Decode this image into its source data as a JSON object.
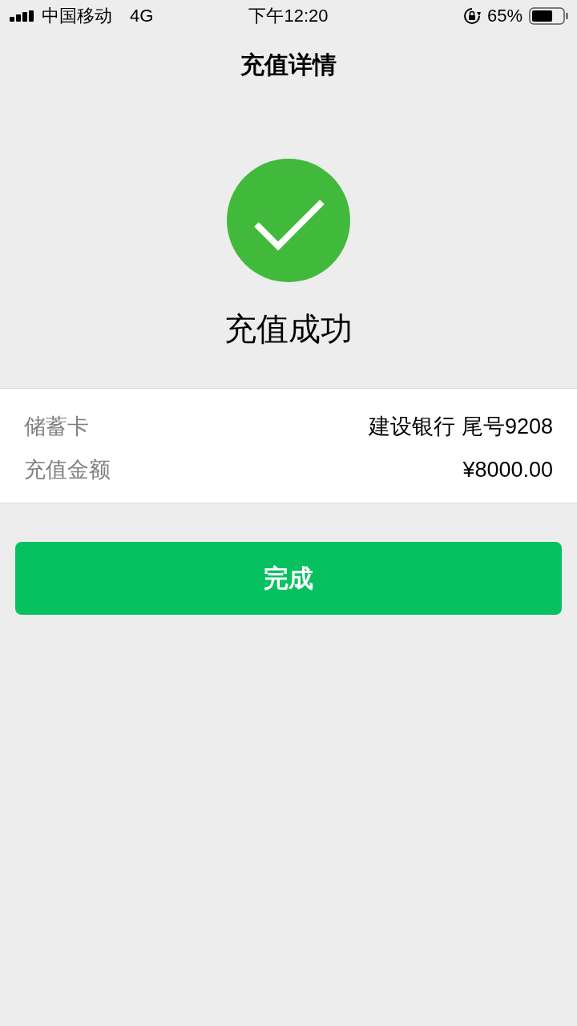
{
  "status_bar": {
    "carrier": "中国移动",
    "network": "4G",
    "time": "下午12:20",
    "battery": "65%"
  },
  "header": {
    "title": "充值详情"
  },
  "result": {
    "message": "充值成功"
  },
  "details": [
    {
      "label": "储蓄卡",
      "value": "建设银行 尾号9208"
    },
    {
      "label": "充值金额",
      "value": "¥8000.00"
    }
  ],
  "button": {
    "label": "完成"
  }
}
